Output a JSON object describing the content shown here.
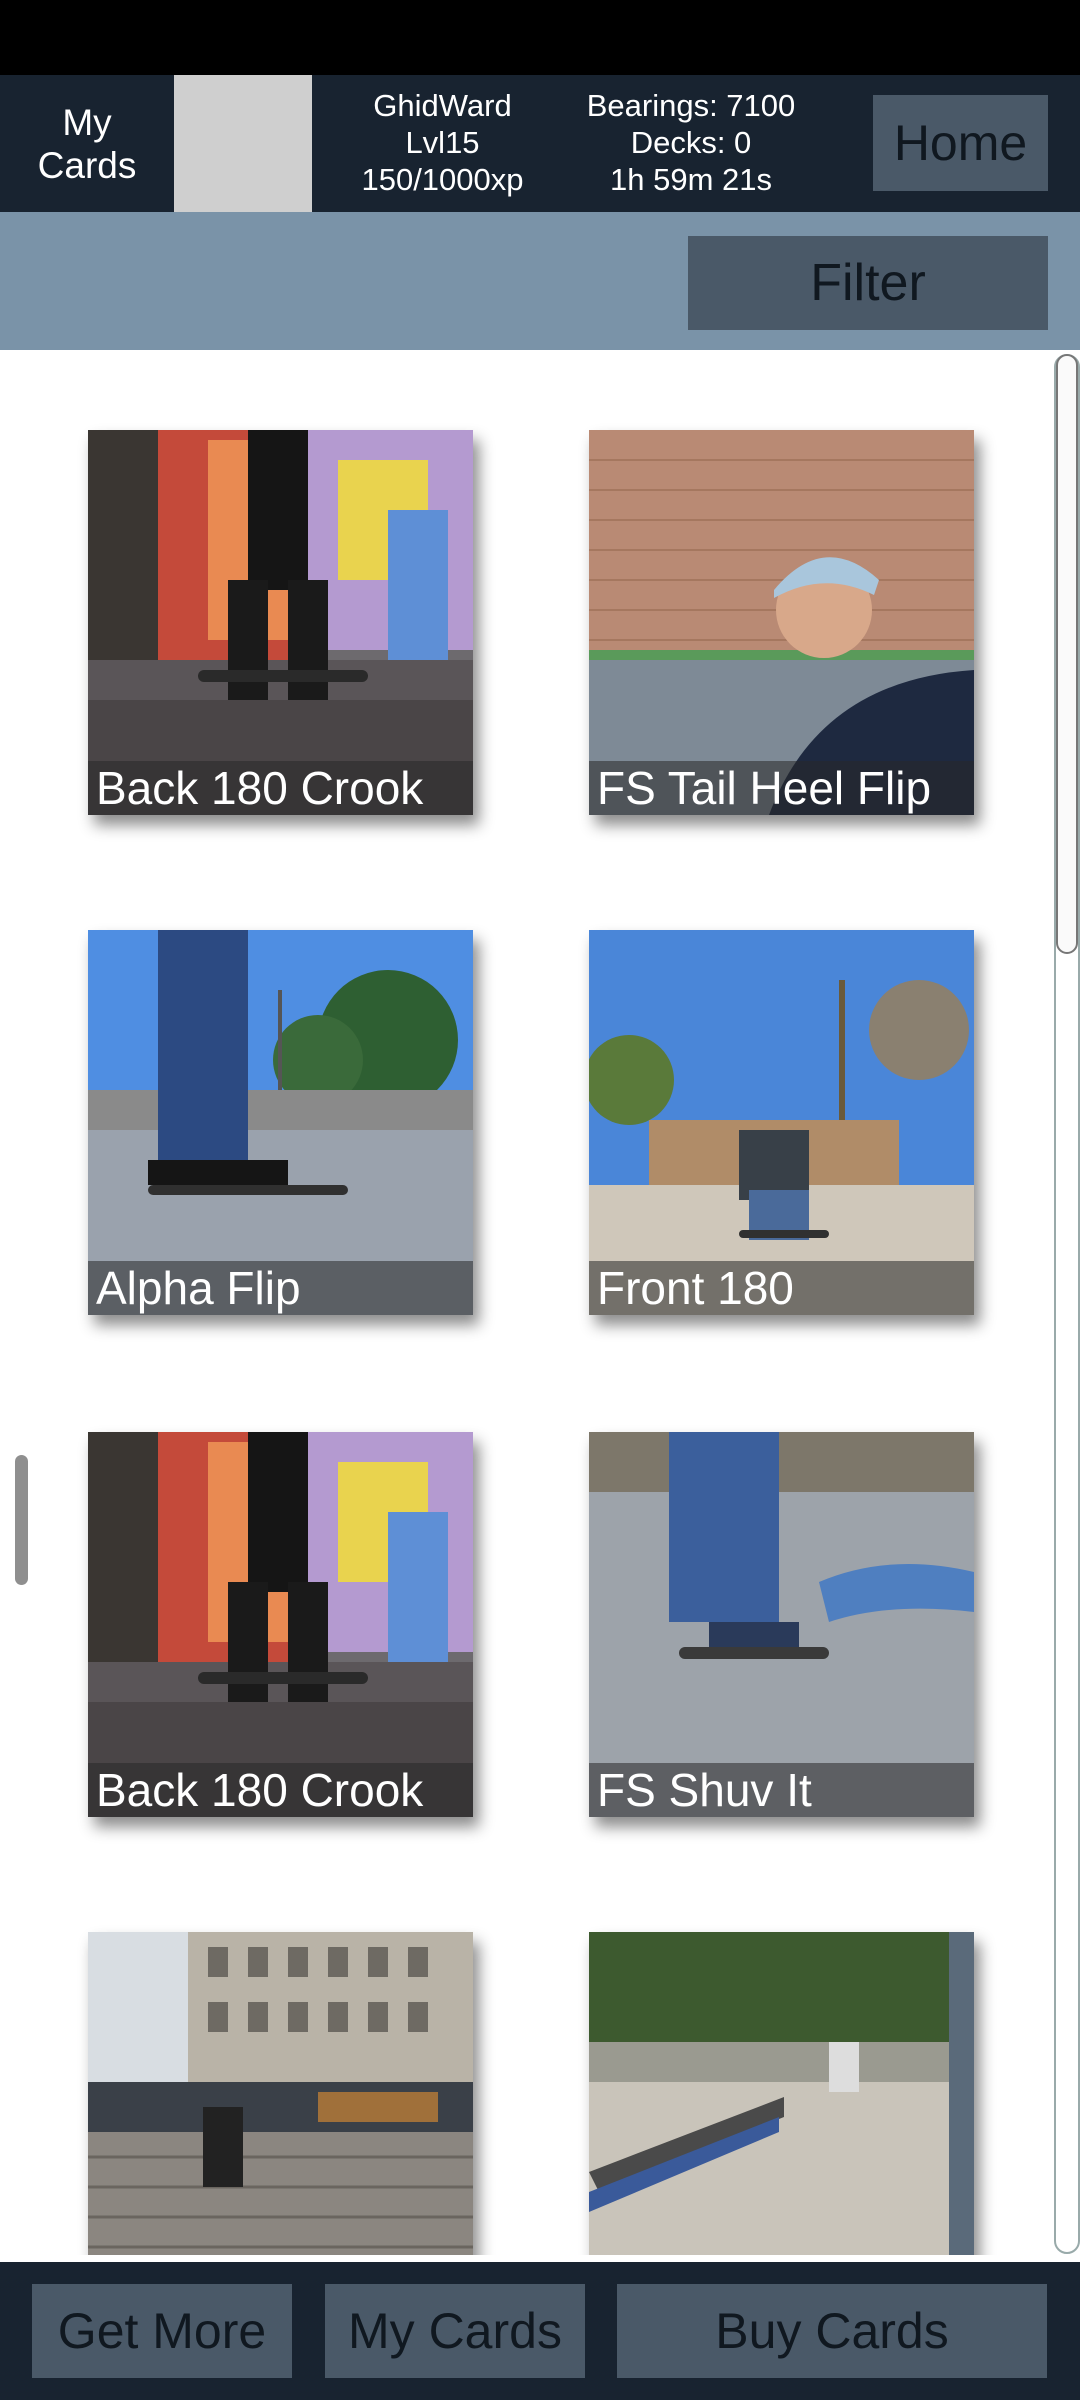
{
  "header": {
    "title": "My\nCards",
    "player": {
      "name": "GhidWard",
      "level": "Lvl15",
      "xp": "150/1000xp"
    },
    "stats": {
      "bearings": "Bearings: 7100",
      "decks": "Decks: 0",
      "timer": "1h 59m 21s"
    },
    "home_label": "Home"
  },
  "filter": {
    "label": "Filter"
  },
  "cards": [
    {
      "title": "Back 180 Crook",
      "scene": "graffiti"
    },
    {
      "title": "FS Tail Heel Flip",
      "scene": "brickwall"
    },
    {
      "title": "Alpha Flip",
      "scene": "sky-park"
    },
    {
      "title": "Front 180",
      "scene": "plaza"
    },
    {
      "title": "Back 180 Crook",
      "scene": "graffiti"
    },
    {
      "title": "FS Shuv It",
      "scene": "concrete"
    },
    {
      "title": "",
      "scene": "stairs"
    },
    {
      "title": "",
      "scene": "ledge"
    }
  ],
  "bottom_nav": {
    "get_more": "Get More",
    "my_cards": "My Cards",
    "buy_cards": "Buy Cards"
  }
}
